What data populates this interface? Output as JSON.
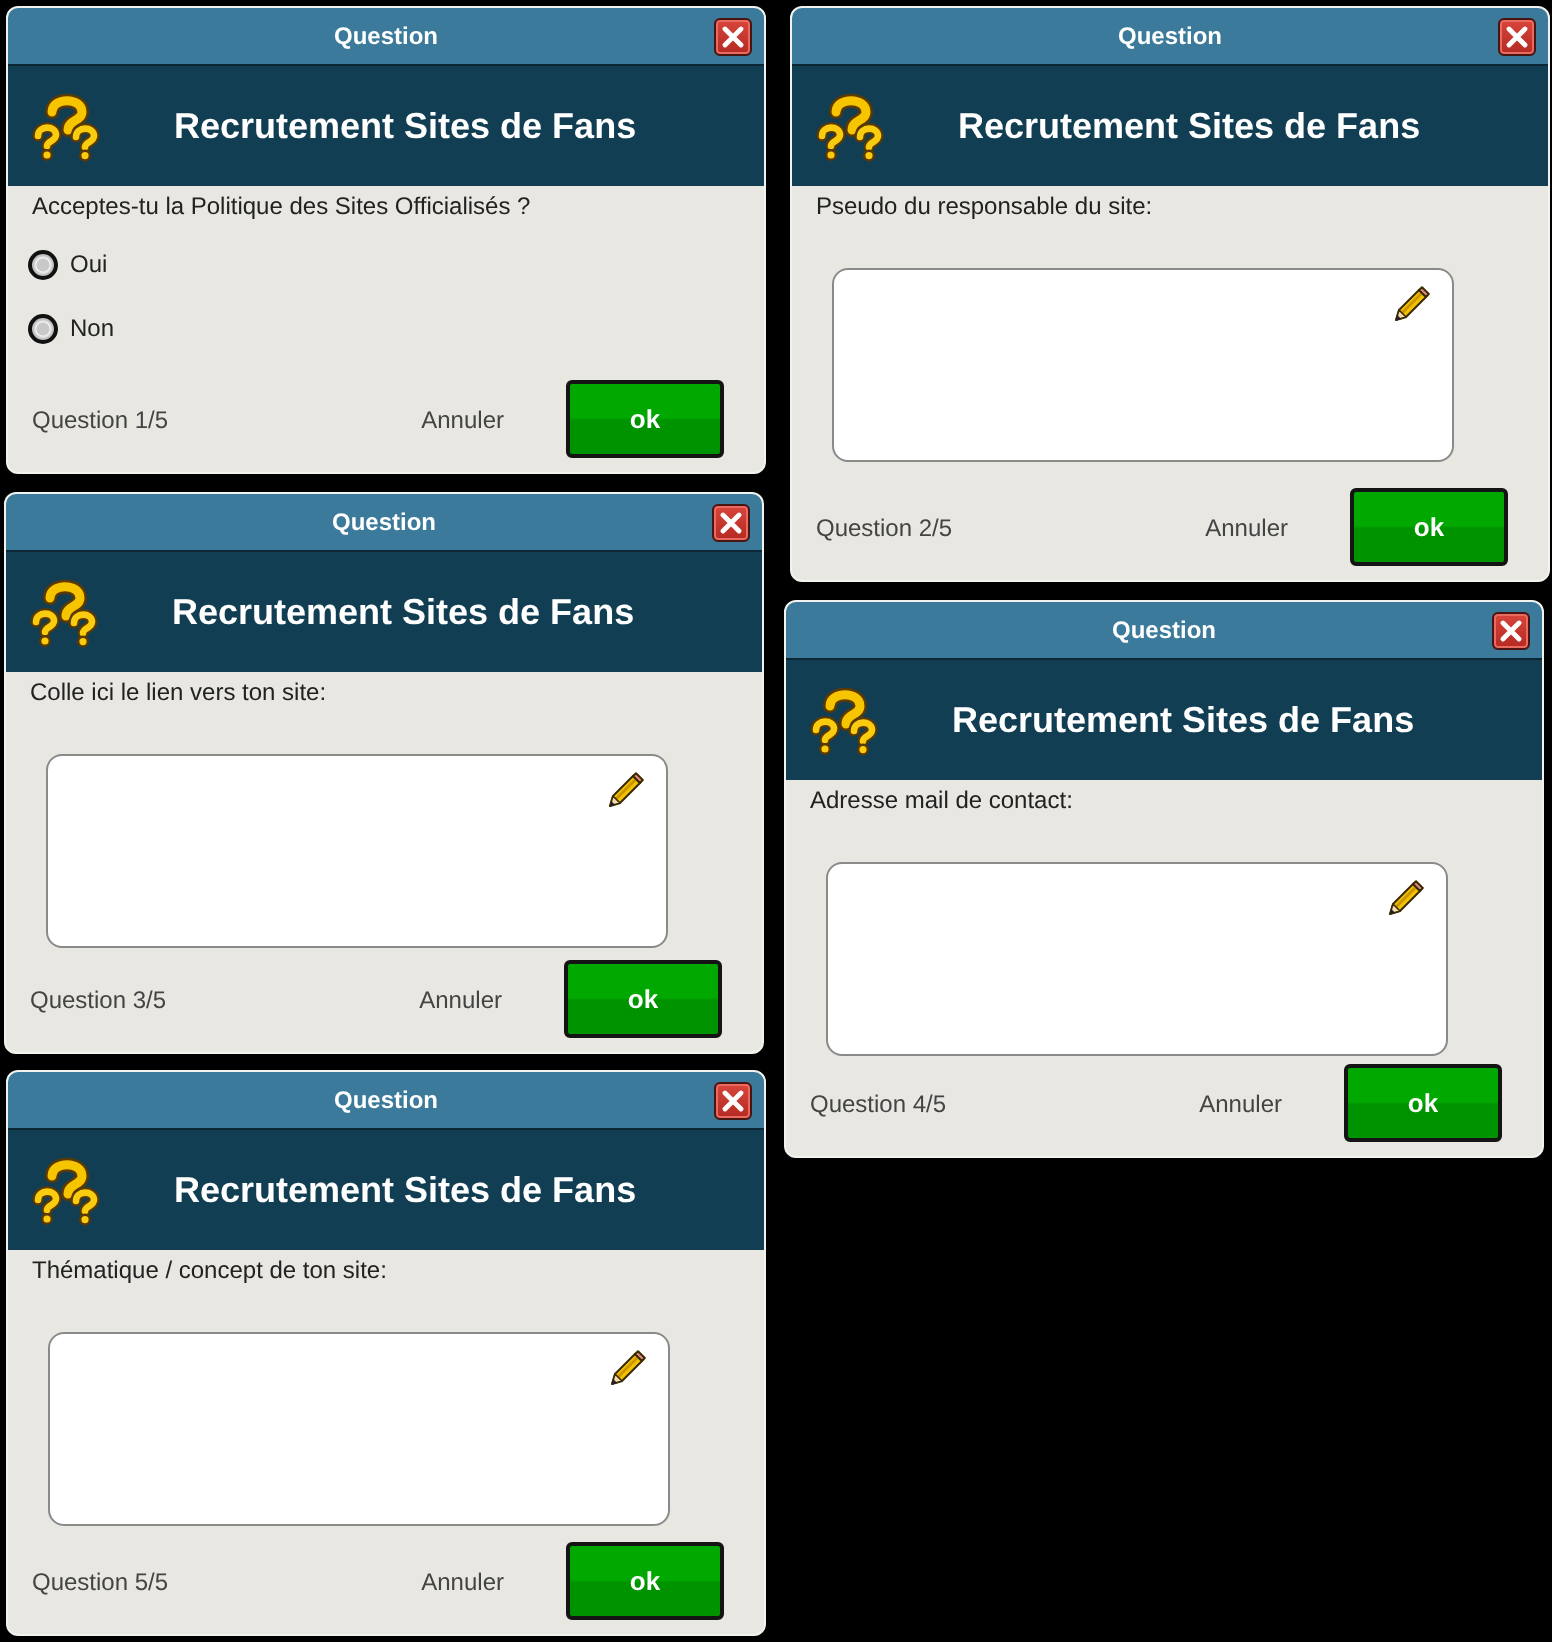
{
  "windows": [
    {
      "title": "Question",
      "heading": "Recrutement Sites de Fans",
      "prompt": "Acceptes-tu la Politique des Sites Officialisés ?",
      "kind": "choice",
      "options": [
        {
          "label": "Oui",
          "selected": false
        },
        {
          "label": "Non",
          "selected": false
        }
      ],
      "progress": "Question 1/5",
      "cancel": "Annuler",
      "confirm": "ok"
    },
    {
      "title": "Question",
      "heading": "Recrutement Sites de Fans",
      "prompt": "Pseudo du responsable du site:",
      "kind": "text",
      "progress": "Question 2/5",
      "cancel": "Annuler",
      "confirm": "ok"
    },
    {
      "title": "Question",
      "heading": "Recrutement Sites de Fans",
      "prompt": "Colle ici le lien vers ton site:",
      "kind": "text",
      "progress": "Question 3/5",
      "cancel": "Annuler",
      "confirm": "ok"
    },
    {
      "title": "Question",
      "heading": "Recrutement Sites de Fans",
      "prompt": "Adresse mail de contact:",
      "kind": "text",
      "progress": "Question 4/5",
      "cancel": "Annuler",
      "confirm": "ok"
    },
    {
      "title": "Question",
      "heading": "Recrutement Sites de Fans",
      "prompt": "Thématique / concept de ton site:",
      "kind": "text",
      "progress": "Question 5/5",
      "cancel": "Annuler",
      "confirm": "ok"
    }
  ]
}
